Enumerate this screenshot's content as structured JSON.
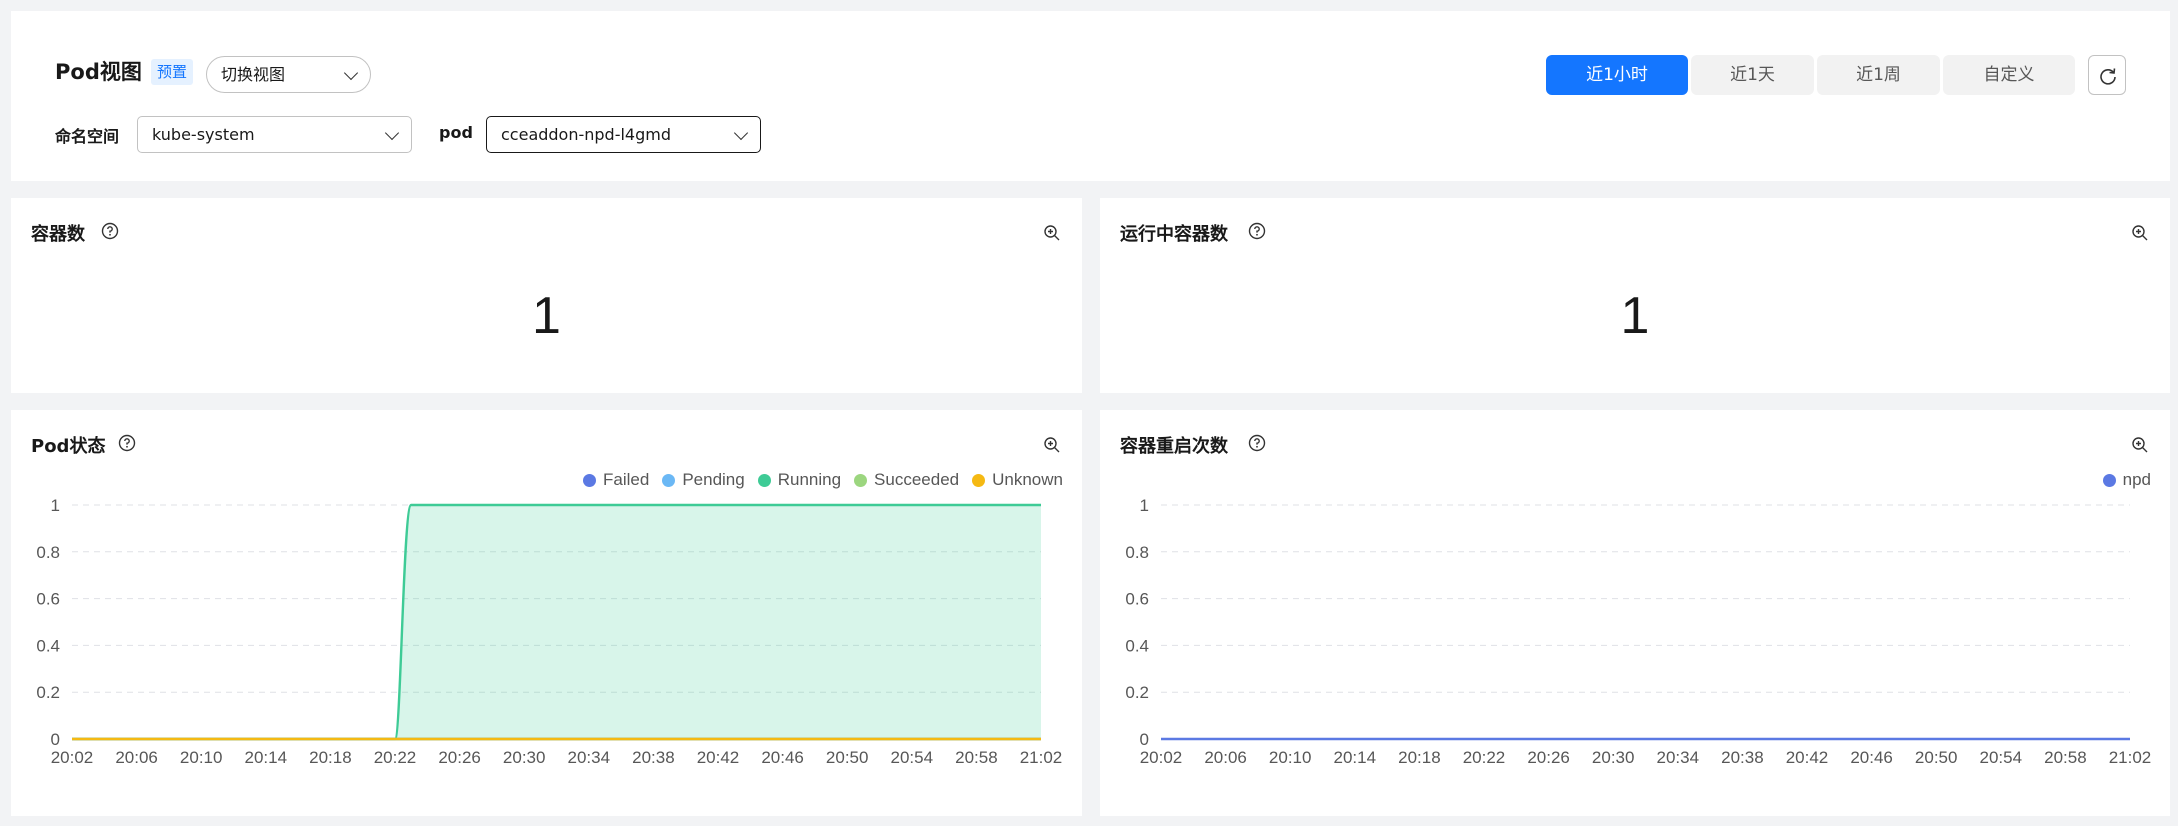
{
  "header": {
    "title": "Pod视图",
    "preset_tag": "预置",
    "view_select": "切换视图",
    "time_ranges": [
      "近1小时",
      "近1天",
      "近1周",
      "自定义"
    ],
    "active_range": "近1小时"
  },
  "filters": {
    "namespace_label": "命名空间",
    "namespace_value": "kube-system",
    "pod_label": "pod",
    "pod_value": "cceaddon-npd-l4gmd"
  },
  "cards": {
    "containers": {
      "title": "容器数",
      "value": "1"
    },
    "running": {
      "title": "运行中容器数",
      "value": "1"
    },
    "pod_status": {
      "title": "Pod状态"
    },
    "restarts": {
      "title": "容器重启次数"
    }
  },
  "chart_data": [
    {
      "type": "area",
      "title": "Pod状态",
      "x": [
        "20:02",
        "20:06",
        "20:10",
        "20:14",
        "20:18",
        "20:22",
        "20:26",
        "20:30",
        "20:34",
        "20:38",
        "20:42",
        "20:46",
        "20:50",
        "20:54",
        "20:58",
        "21:02"
      ],
      "ylim": [
        0,
        1
      ],
      "yticks": [
        0,
        0.2,
        0.4,
        0.6,
        0.8,
        1
      ],
      "yticklabels": [
        "0",
        "0.2",
        "0.4",
        "0.6",
        "0.8",
        "1"
      ],
      "grid": true,
      "legend_position": "top-right",
      "series": [
        {
          "name": "Failed",
          "color": "#5b79e3",
          "values": [
            0,
            0,
            0,
            0,
            0,
            0,
            0,
            0,
            0,
            0,
            0,
            0,
            0,
            0,
            0,
            0
          ]
        },
        {
          "name": "Pending",
          "color": "#6bb8f5",
          "values": [
            0,
            0,
            0,
            0,
            0,
            0,
            0,
            0,
            0,
            0,
            0,
            0,
            0,
            0,
            0,
            0
          ]
        },
        {
          "name": "Running",
          "color": "#3ecb96",
          "values": [
            0,
            0,
            0,
            0,
            0,
            1,
            1,
            1,
            1,
            1,
            1,
            1,
            1,
            1,
            1,
            1
          ],
          "transition": [
            "20:22",
            "20:23"
          ]
        },
        {
          "name": "Succeeded",
          "color": "#9cd67f",
          "values": [
            0,
            0,
            0,
            0,
            0,
            0,
            0,
            0,
            0,
            0,
            0,
            0,
            0,
            0,
            0,
            0
          ]
        },
        {
          "name": "Unknown",
          "color": "#f5b913",
          "values": [
            0,
            0,
            0,
            0,
            0,
            0,
            0,
            0,
            0,
            0,
            0,
            0,
            0,
            0,
            0,
            0
          ]
        }
      ]
    },
    {
      "type": "line",
      "title": "容器重启次数",
      "x": [
        "20:02",
        "20:06",
        "20:10",
        "20:14",
        "20:18",
        "20:22",
        "20:26",
        "20:30",
        "20:34",
        "20:38",
        "20:42",
        "20:46",
        "20:50",
        "20:54",
        "20:58",
        "21:02"
      ],
      "ylim": [
        0,
        1
      ],
      "yticks": [
        0,
        0.2,
        0.4,
        0.6,
        0.8,
        1
      ],
      "yticklabels": [
        "0",
        "0.2",
        "0.4",
        "0.6",
        "0.8",
        "1"
      ],
      "grid": true,
      "legend_position": "top-right",
      "series": [
        {
          "name": "npd",
          "color": "#5b79e3",
          "values": [
            0,
            0,
            0,
            0,
            0,
            0,
            0,
            0,
            0,
            0,
            0,
            0,
            0,
            0,
            0,
            0
          ]
        }
      ]
    }
  ]
}
